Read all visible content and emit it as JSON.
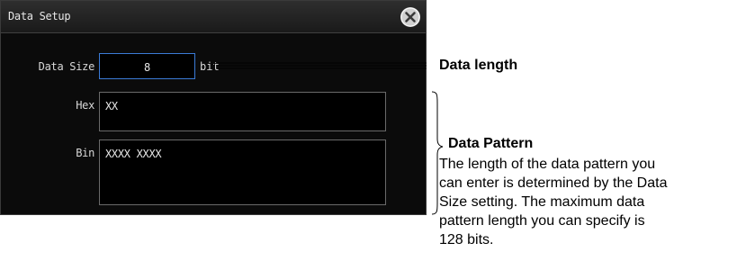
{
  "dialog": {
    "title": "Data Setup",
    "close_icon": "close-icon",
    "data_size": {
      "label": "Data Size",
      "value": "8",
      "unit": "bit"
    },
    "hex": {
      "label": "Hex",
      "value": "XX"
    },
    "bin": {
      "label": "Bin",
      "value": "XXXX XXXX"
    }
  },
  "annotations": {
    "data_length": "Data length",
    "data_pattern_title": "Data Pattern",
    "data_pattern_description": [
      "The length of the data pattern you",
      "can enter is determined by the Data",
      "Size setting. The maximum data",
      "pattern length you can specify is",
      "128 bits."
    ]
  },
  "colors": {
    "dialog_background": "#0b0b0b",
    "active_border": "#3b7bd6",
    "field_border": "#6a6a6a",
    "text": "#e8e8e8"
  }
}
